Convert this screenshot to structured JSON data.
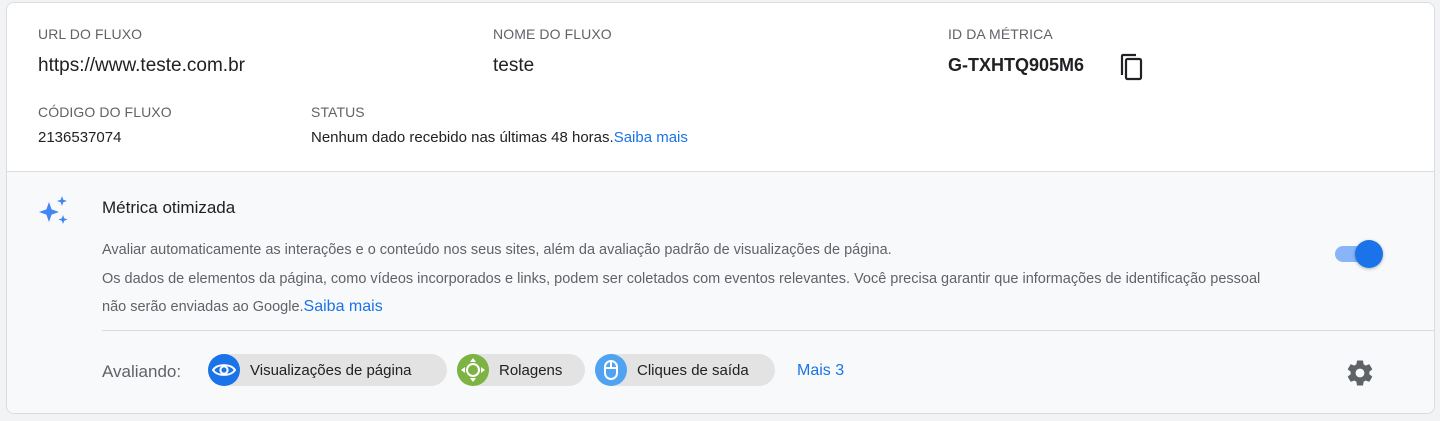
{
  "stream": {
    "url_label": "URL DO FLUXO",
    "url_value": "https://www.teste.com.br",
    "name_label": "NOME DO FLUXO",
    "name_value": "teste",
    "metric_label": "ID DA MÉTRICA",
    "metric_value": "G-TXHTQ905M6",
    "code_label": "CÓDIGO DO FLUXO",
    "code_value": "2136537074",
    "status_label": "STATUS",
    "status_text": "Nenhum dado recebido nas últimas 48 horas.",
    "status_link": "Saiba mais"
  },
  "enhanced": {
    "title": "Métrica otimizada",
    "desc_line1": "Avaliar automaticamente as interações e o conteúdo nos seus sites, além da avaliação padrão de visualizações de página.",
    "desc_line2": "Os dados de elementos da página, como vídeos incorporados e links, podem ser coletados com eventos relevantes. Você precisa garantir que informações de identificação pessoal não serão enviadas ao Google.",
    "desc_link": "Saiba mais",
    "toggle_on": true,
    "measuring_label": "Avaliando:",
    "chips": [
      {
        "label": "Visualizações de página",
        "icon": "eye-icon",
        "color": "#1a73e8"
      },
      {
        "label": "Rolagens",
        "icon": "scroll-arrows-icon",
        "color": "#7cb342"
      },
      {
        "label": "Cliques de saída",
        "icon": "mouse-icon",
        "color": "#4fa3f0"
      }
    ],
    "more_label": "Mais 3"
  },
  "colors": {
    "accent": "#1a73e8",
    "sparkle": "#4285f4"
  }
}
